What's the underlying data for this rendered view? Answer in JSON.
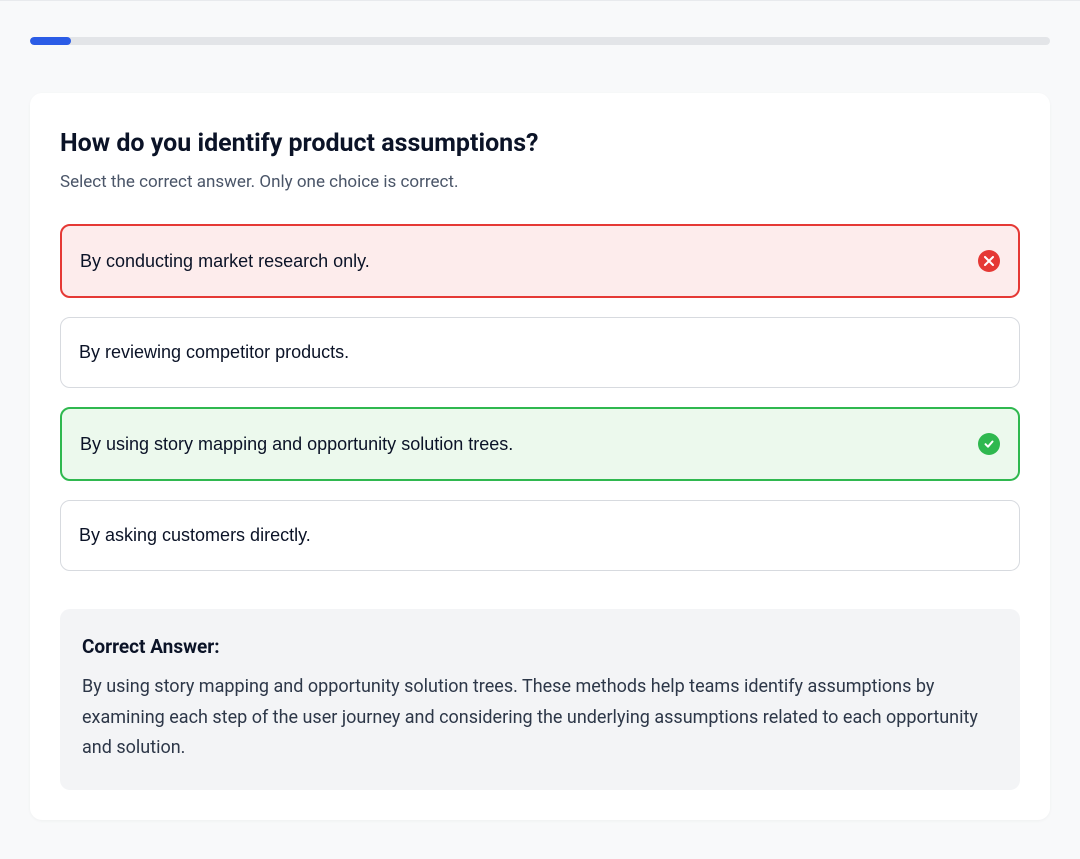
{
  "progress": {
    "percent": 4
  },
  "quiz": {
    "question": "How do you identify product assumptions?",
    "instruction": "Select the correct answer. Only one choice is correct.",
    "options": [
      {
        "text": "By conducting market research only.",
        "state": "incorrect"
      },
      {
        "text": "By reviewing competitor products.",
        "state": "neutral"
      },
      {
        "text": "By using story mapping and opportunity solution trees.",
        "state": "correct"
      },
      {
        "text": "By asking customers directly.",
        "state": "neutral"
      }
    ],
    "explanation": {
      "heading": "Correct Answer:",
      "text": "By using story mapping and opportunity solution trees. These methods help teams identify assumptions by examining each step of the user journey and considering the underlying assumptions related to each opportunity and solution."
    }
  }
}
